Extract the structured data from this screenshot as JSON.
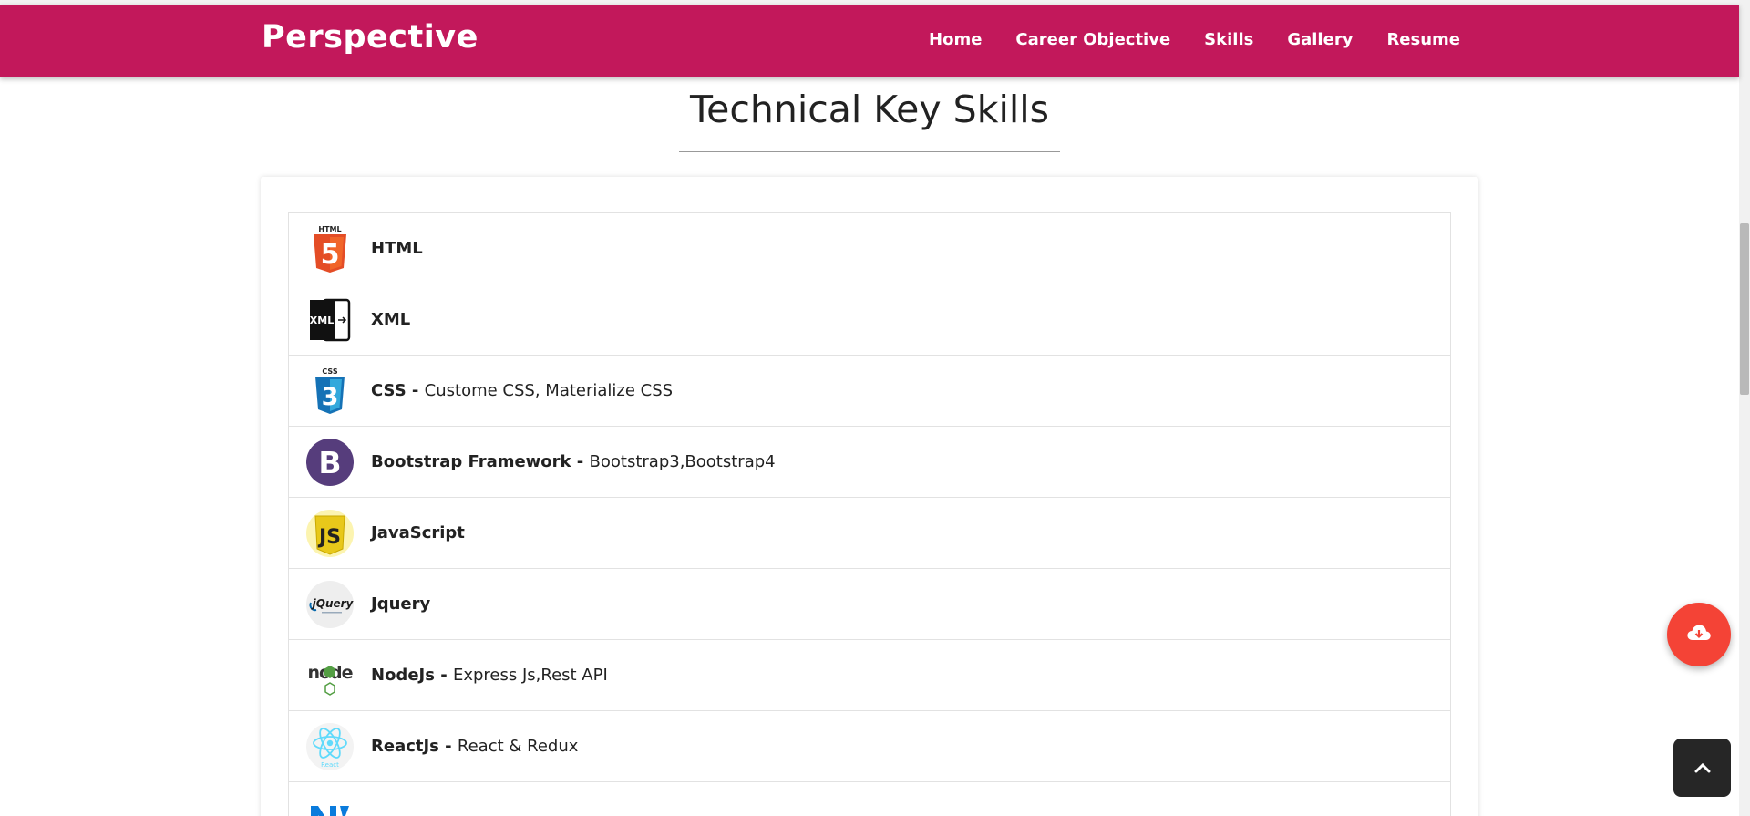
{
  "navbar": {
    "brand": "Perspective",
    "background": "#c2185b",
    "links": [
      "Home",
      "Career Objective",
      "Skills",
      "Gallery",
      "Resume"
    ]
  },
  "section": {
    "title": "Technical Key Skills"
  },
  "skills": [
    {
      "name": "HTML",
      "detail": "",
      "icon": "html5-logo-icon"
    },
    {
      "name": "XML",
      "detail": "",
      "icon": "xml-logo-icon"
    },
    {
      "name": "CSS - ",
      "detail": "Custome CSS, Materialize CSS",
      "icon": "css3-logo-icon"
    },
    {
      "name": "Bootstrap Framework - ",
      "detail": "Bootstrap3,Bootstrap4",
      "icon": "bootstrap-logo-icon"
    },
    {
      "name": "JavaScript",
      "detail": "",
      "icon": "javascript-logo-icon"
    },
    {
      "name": "Jquery",
      "detail": "",
      "icon": "jquery-logo-icon"
    },
    {
      "name": "NodeJs - ",
      "detail": "Express Js,Rest API",
      "icon": "nodejs-logo-icon"
    },
    {
      "name": "ReactJs - ",
      "detail": "React & Redux",
      "icon": "react-logo-icon"
    },
    {
      "name": "",
      "detail": "",
      "icon": "partial-logo-icon"
    }
  ],
  "logo_text": {
    "html5_top": "HTML",
    "html5_digit": "5",
    "xml": "XML",
    "css3_top": "CSS",
    "css3_digit": "3",
    "bootstrap": "B",
    "js": "JS",
    "jquery": "jQuery",
    "node": "node",
    "react": "React"
  },
  "buttons": {
    "download_icon": "cloud-download-icon",
    "back_to_top_icon": "chevron-up-icon"
  },
  "colors": {
    "accent": "#c2185b",
    "fab": "#f44336",
    "back_to_top": "#262626"
  }
}
